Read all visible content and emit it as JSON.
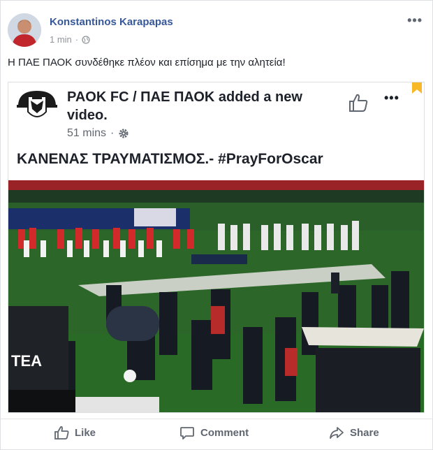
{
  "post": {
    "author": "Konstantinos Karapapas",
    "time": "1 min",
    "separator": "·",
    "text": "Η ΠΑΕ ΠΑΟΚ συνδέθηκε πλέον και επίσημα με την αλητεία!",
    "more_icon": "more-icon",
    "privacy_icon": "globe-icon"
  },
  "shared": {
    "page_name": "PAOK FC / ΠΑΕ ΠΑΟΚ",
    "action": "added a new video.",
    "title": "PAOK FC / ΠΑΕ ΠΑΟΚ added a new video.",
    "time": "51 mins",
    "separator": "·",
    "caption": "ΚΑΝΕΝΑΣ ΤΡΑΥΜΑΤΙΣΜΟΣ.- #PrayForOscar",
    "like_icon": "thumbs-up-icon",
    "settings_icon": "gear-icon",
    "logo_icon": "paok-logo-icon"
  },
  "actions": {
    "like": "Like",
    "comment": "Comment",
    "share": "Share"
  },
  "colors": {
    "author_link": "#365899",
    "muted": "#90949c",
    "pitch": "#2f6a2c",
    "bookmark": "#f7b928"
  }
}
